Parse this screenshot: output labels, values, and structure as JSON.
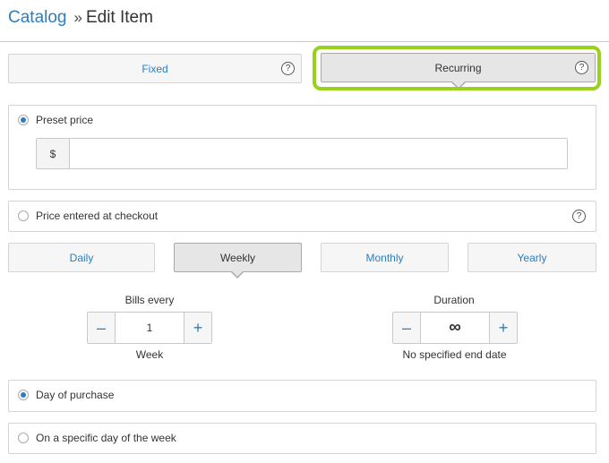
{
  "breadcrumb": {
    "root": "Catalog",
    "separator": "»",
    "current": "Edit Item"
  },
  "pricing_type": {
    "tabs": [
      {
        "label": "Fixed",
        "help": "?"
      },
      {
        "label": "Recurring",
        "help": "?"
      }
    ],
    "selected": "Recurring"
  },
  "price_options": {
    "preset": {
      "label": "Preset price",
      "currency": "$",
      "value": "",
      "selected": true
    },
    "checkout": {
      "label": "Price entered at checkout",
      "help": "?",
      "selected": false
    }
  },
  "frequency": {
    "options": [
      {
        "label": "Daily"
      },
      {
        "label": "Weekly"
      },
      {
        "label": "Monthly"
      },
      {
        "label": "Yearly"
      }
    ],
    "selected": "Weekly"
  },
  "bills_every": {
    "label": "Bills every",
    "minus": "–",
    "value": "1",
    "plus": "+",
    "unit": "Week"
  },
  "duration": {
    "label": "Duration",
    "minus": "–",
    "value": "∞",
    "plus": "+",
    "caption": "No specified end date"
  },
  "billing_day": {
    "purchase": {
      "label": "Day of purchase",
      "selected": true
    },
    "specific": {
      "label": "On a specific day of the week",
      "selected": false
    }
  },
  "colors": {
    "accent": "#2b7ec1",
    "highlight": "#98d21c"
  }
}
